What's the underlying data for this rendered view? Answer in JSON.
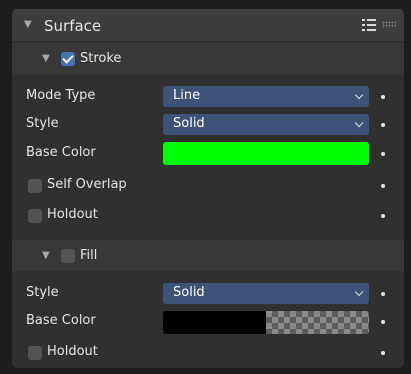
{
  "surface": {
    "title": "Surface",
    "header_icons": [
      "list-icon",
      "drag-grip-icon"
    ],
    "stroke": {
      "title": "Stroke",
      "enabled": true,
      "mode_type": {
        "label": "Mode Type",
        "value": "Line"
      },
      "style": {
        "label": "Style",
        "value": "Solid"
      },
      "base_color": {
        "label": "Base Color",
        "color": "#00ff00"
      },
      "self_overlap": {
        "label": "Self Overlap",
        "checked": false
      },
      "holdout": {
        "label": "Holdout",
        "checked": false
      }
    },
    "fill": {
      "title": "Fill",
      "enabled": false,
      "style": {
        "label": "Style",
        "value": "Solid"
      },
      "base_color": {
        "label": "Base Color",
        "color": "#000000",
        "alpha": 0.0
      },
      "holdout": {
        "label": "Holdout",
        "checked": false
      }
    }
  },
  "colors": {
    "panel_bg": "#303030",
    "header_bg": "#3d3d3d",
    "dropdown_bg": "#3d5478",
    "checkbox_on": "#4772b3",
    "checkbox_off": "#545454"
  }
}
